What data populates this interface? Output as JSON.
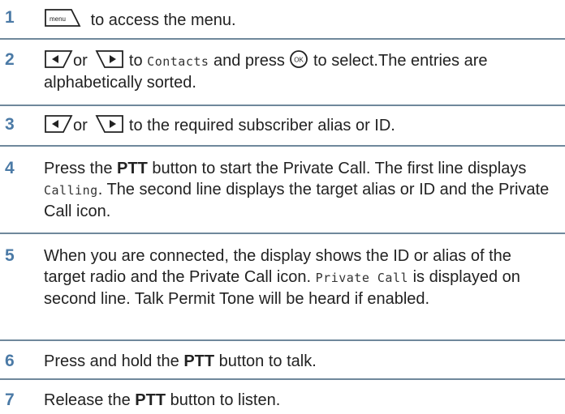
{
  "steps": [
    {
      "number": "1",
      "menu_key_label": "menu",
      "text_after_key": "to access the menu."
    },
    {
      "number": "2",
      "or_text": "or",
      "to_text": "to",
      "contacts_label": "Contacts",
      "and_press_text": "and press",
      "ok_key_label": "OK",
      "text_after_ok": "to select.The entries are alphabetically sorted."
    },
    {
      "number": "3",
      "or_text": "or",
      "text_after_keys": "to the required subscriber alias or ID."
    },
    {
      "number": "4",
      "text_a": "Press the ",
      "ptt": "PTT",
      "text_b": " button to start the Private Call. The first line displays ",
      "calling_label": "Calling",
      "text_c": ". The second line displays the target alias or ID and the Private Call icon."
    },
    {
      "number": "5",
      "text_a": "When you are connected, the display shows the ID or alias of the target radio and the Private Call icon. ",
      "private_call_label": "Private Call",
      "text_b": " is displayed on second line. Talk Permit Tone will be heard if enabled."
    },
    {
      "number": "6",
      "text_a": "Press and hold the ",
      "ptt": "PTT",
      "text_b": " button to talk."
    },
    {
      "number": "7",
      "text_a": "Release the ",
      "ptt": "PTT",
      "text_b": " button to listen."
    }
  ],
  "colors": {
    "step_number": "#4b7aa6",
    "divider": "#6f889b",
    "text": "#222222"
  }
}
